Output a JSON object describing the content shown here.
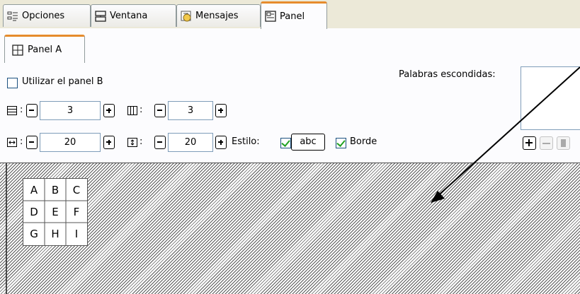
{
  "tabs": [
    {
      "label": "Opciones",
      "icon": "list-icon",
      "active": false
    },
    {
      "label": "Ventana",
      "icon": "window-icon",
      "active": false
    },
    {
      "label": "Mensajes",
      "icon": "messages-icon",
      "active": false
    },
    {
      "label": "Panel",
      "icon": "panel-icon",
      "active": true
    }
  ],
  "subtab": {
    "label": "Panel A",
    "icon": "grid-icon"
  },
  "options": {
    "use_panel_b": {
      "label": "Utilizar el panel B",
      "checked": false
    },
    "rows": {
      "icon": "rows-icon",
      "value": "3"
    },
    "cols": {
      "icon": "columns-icon",
      "value": "3"
    },
    "hspacing": {
      "icon": "horizontal-spacing-icon",
      "value": "20"
    },
    "vspacing": {
      "icon": "vertical-spacing-icon",
      "value": "20"
    },
    "style_label": "Estilo:",
    "style_preview": "abc",
    "style_checked": true,
    "border": {
      "label": "Borde",
      "checked": true
    },
    "colon": ":"
  },
  "hidden_words": {
    "label": "Palabras escondidas:"
  },
  "grid_cells": [
    [
      "A",
      "B",
      "C"
    ],
    [
      "D",
      "E",
      "F"
    ],
    [
      "G",
      "H",
      "I"
    ]
  ],
  "colors": {
    "accent": "#e68b2c",
    "check": "#21a121",
    "tab_border": "#919b9c"
  }
}
